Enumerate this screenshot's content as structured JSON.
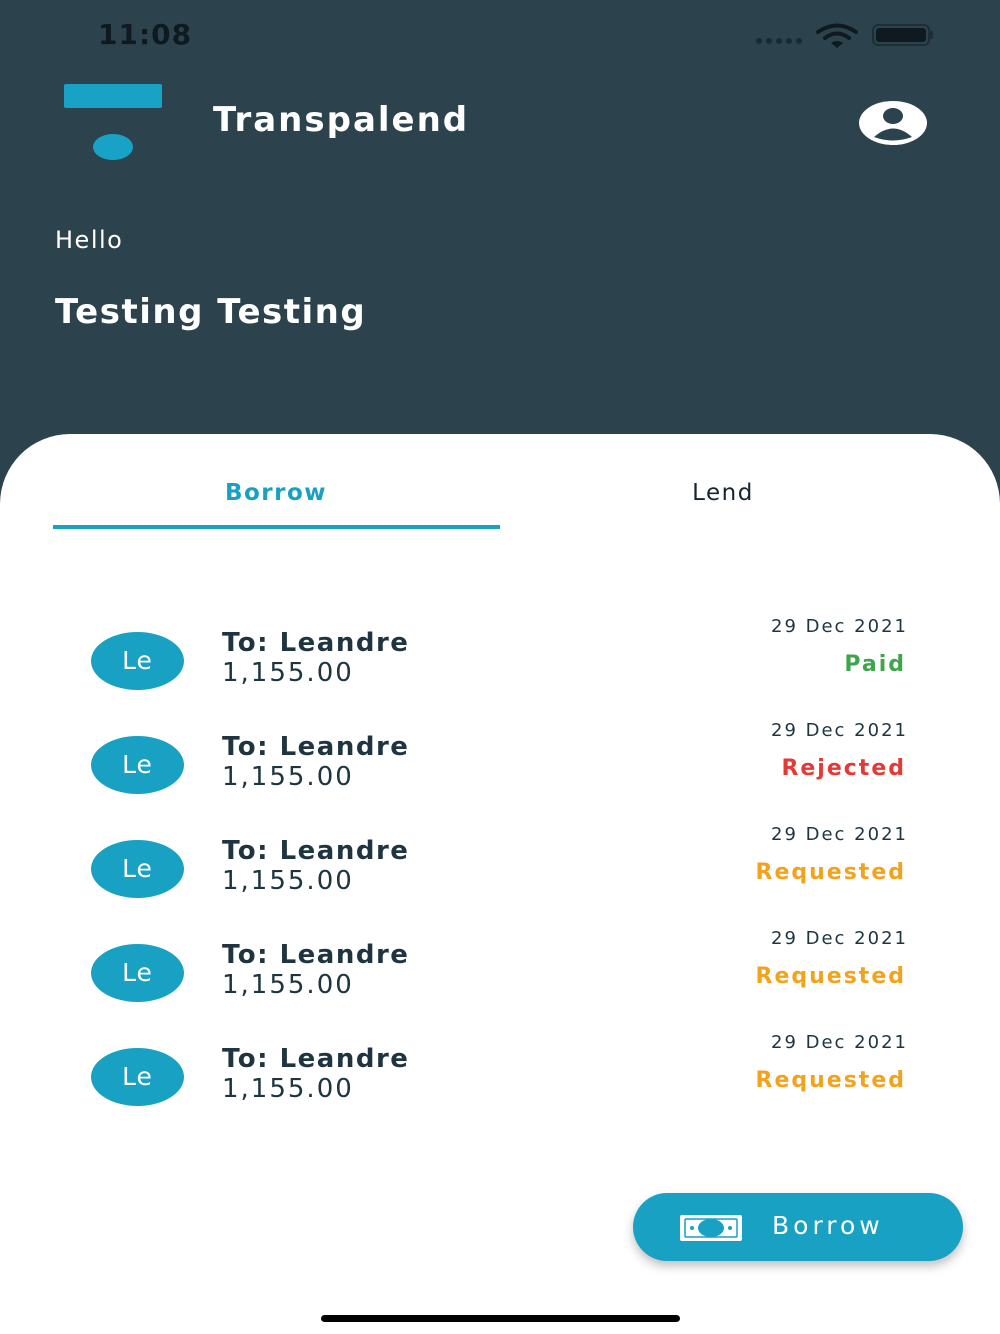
{
  "status_bar": {
    "time": "11:08"
  },
  "header": {
    "app_title": "Transpalend",
    "logo_icon": "transpalend-logo",
    "profile_icon": "user-icon"
  },
  "greeting": {
    "hello": "Hello",
    "name": "Testing Testing"
  },
  "tabs": [
    {
      "label": "Borrow",
      "active": true
    },
    {
      "label": "Lend",
      "active": false
    }
  ],
  "transactions": [
    {
      "initials": "Le",
      "to": "To: Leandre",
      "amount": "1,155.00",
      "date": "29 Dec 2021",
      "status": "Paid",
      "status_color": "#3ea54a"
    },
    {
      "initials": "Le",
      "to": "To: Leandre",
      "amount": "1,155.00",
      "date": "29 Dec 2021",
      "status": "Rejected",
      "status_color": "#e53935"
    },
    {
      "initials": "Le",
      "to": "To: Leandre",
      "amount": "1,155.00",
      "date": "29 Dec 2021",
      "status": "Requested",
      "status_color": "#f2a31b"
    },
    {
      "initials": "Le",
      "to": "To: Leandre",
      "amount": "1,155.00",
      "date": "29 Dec 2021",
      "status": "Requested",
      "status_color": "#f2a31b"
    },
    {
      "initials": "Le",
      "to": "To: Leandre",
      "amount": "1,155.00",
      "date": "29 Dec 2021",
      "status": "Requested",
      "status_color": "#f2a31b"
    }
  ],
  "fab": {
    "label": "Borrow",
    "icon": "money-icon"
  },
  "colors": {
    "header_bg": "#2c434d",
    "accent": "#19a1c4",
    "text_dark": "#1e3540"
  }
}
